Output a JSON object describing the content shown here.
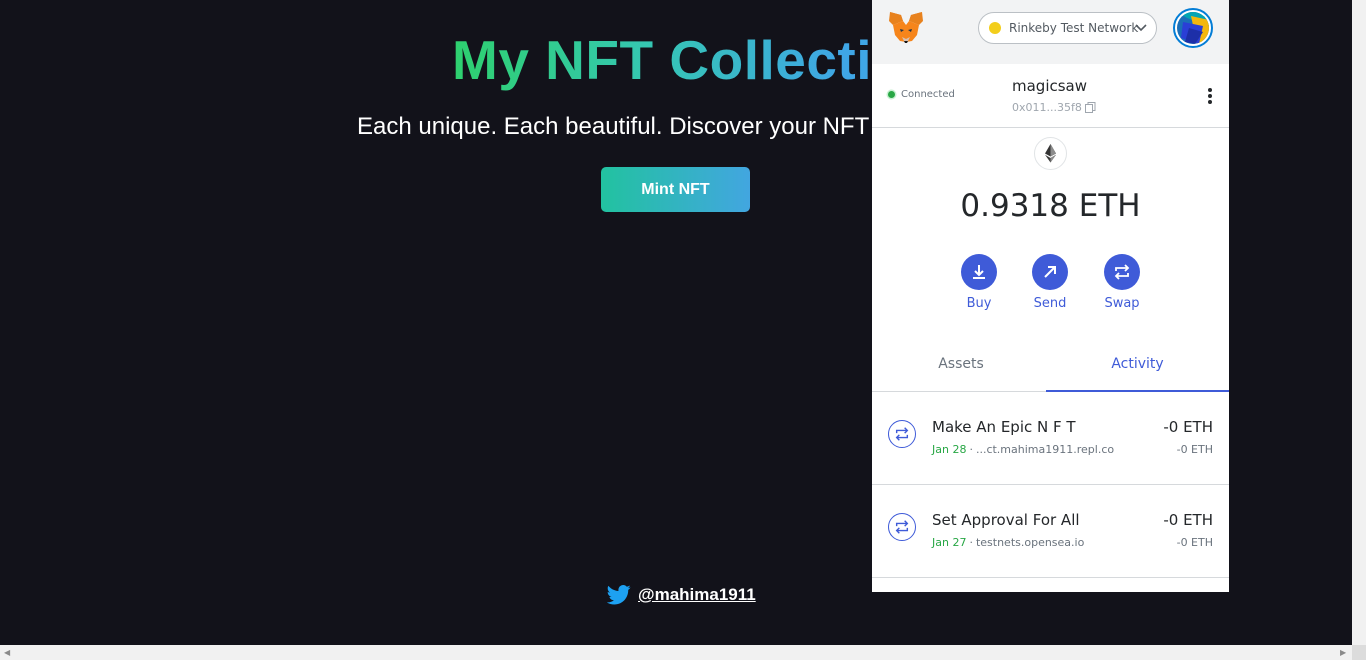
{
  "page": {
    "title": "My NFT Collection",
    "subtitle": "Each unique. Each beautiful. Discover your NFT today.",
    "mint_button": "Mint NFT",
    "twitter_handle": "@mahima1911"
  },
  "wallet": {
    "network": "Rinkeby Test Network",
    "connection_status": "Connected",
    "account_name": "magicsaw",
    "account_address": "0x011...35f8",
    "balance": "0.9318 ETH",
    "actions": [
      {
        "label": "Buy",
        "icon": "download-icon"
      },
      {
        "label": "Send",
        "icon": "arrow-up-right-icon"
      },
      {
        "label": "Swap",
        "icon": "swap-icon"
      }
    ],
    "tabs": [
      {
        "label": "Assets",
        "active": false
      },
      {
        "label": "Activity",
        "active": true
      }
    ],
    "transactions": [
      {
        "title": "Make An Epic N F T",
        "date": "Jan 28",
        "origin": "...ct.mahima1911.repl.co",
        "amount": "-0 ETH",
        "amount_secondary": "-0 ETH"
      },
      {
        "title": "Set Approval For All",
        "date": "Jan 27",
        "origin": "testnets.opensea.io",
        "amount": "-0 ETH",
        "amount_secondary": "-0 ETH"
      }
    ]
  },
  "colors": {
    "page_background": "#12121a",
    "metamask_primary": "#3f5bd8",
    "connected_green": "#28a745",
    "network_yellow": "#f3ce1c"
  }
}
